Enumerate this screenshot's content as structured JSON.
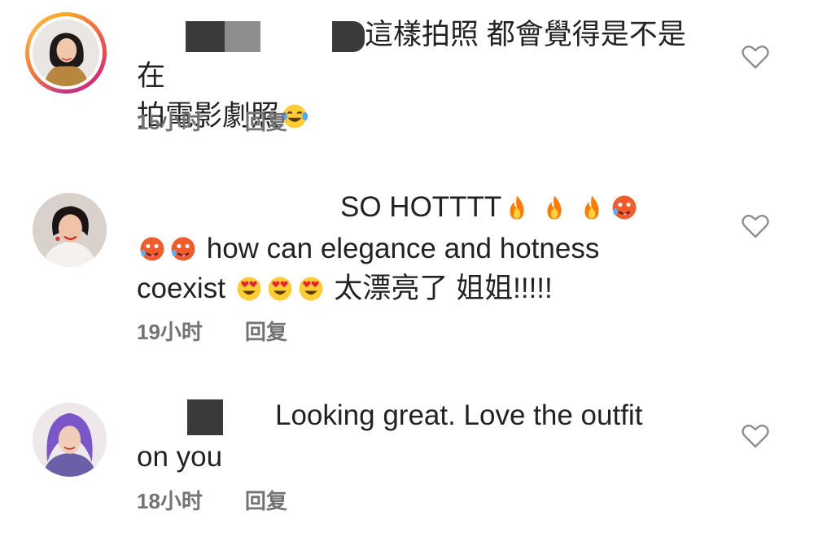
{
  "comments": [
    {
      "text_line1": "這樣拍照 都會覺得是不是在",
      "text_line2": "拍電影劇照",
      "time": "15小时",
      "reply": "回复"
    },
    {
      "text_line1": "SO HOTTTT",
      "text_line2": "how can elegance and hotness",
      "text_line3a": "coexist",
      "text_line3b": "太漂亮了 姐姐!!!!!",
      "time": "19小时",
      "reply": "回复"
    },
    {
      "text_line1": "Looking great. Love the outfit",
      "text_line2": "on you",
      "time": "18小时",
      "reply": "回复"
    }
  ],
  "icons": {
    "like": "heart-outline-icon",
    "laugh": "tears-of-joy-emoji",
    "fire": "fire-emoji",
    "hot_face": "hot-face-emoji",
    "heart_eyes": "heart-eyes-emoji"
  },
  "colors": {
    "meta_text": "#737373",
    "story_ring": "#e1306c"
  }
}
